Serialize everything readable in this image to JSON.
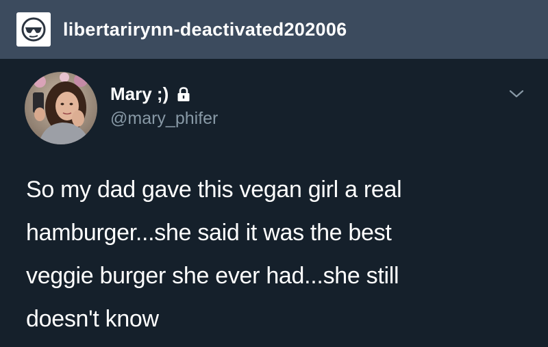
{
  "blog": {
    "name": "libertarirynn-deactivated202006",
    "avatar_icon": "sunglasses-face-icon"
  },
  "tweet": {
    "display_name": "Mary ;)",
    "handle": "@mary_phifer",
    "protected_icon": "lock-icon",
    "menu_icon": "chevron-down-icon",
    "text_lines": [
      "So my dad gave this vegan girl a real",
      "hamburger...she said it was the best",
      "veggie burger she ever had...she still",
      "doesn't know"
    ]
  },
  "colors": {
    "header_bg": "#3c4b5e",
    "tweet_bg": "#15202b",
    "text_primary": "#ffffff",
    "text_secondary": "#8899a6"
  }
}
